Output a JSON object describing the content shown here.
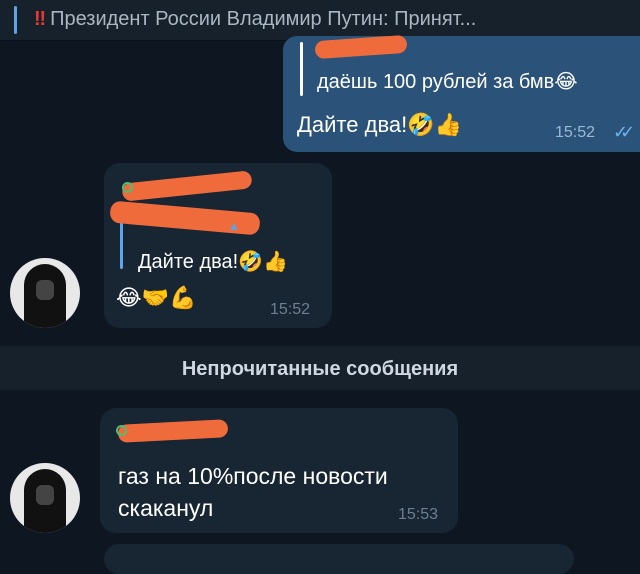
{
  "pinned": {
    "icon": "‼",
    "text": "Президент России Владимир Путин: Принят..."
  },
  "outgoing": {
    "reply_text": "даёшь 100 рублей за бмв😂",
    "text": "Дайте два!🤣👍",
    "time": "15:52",
    "ticks": "✓✓"
  },
  "incoming1": {
    "reply_text": "Дайте два!🤣👍",
    "emoji": "😂🤝💪",
    "time": "15:52"
  },
  "unread_divider": "Непрочитанные сообщения",
  "incoming2": {
    "text": "газ на 10%после новости скаканул",
    "time": "15:53"
  }
}
